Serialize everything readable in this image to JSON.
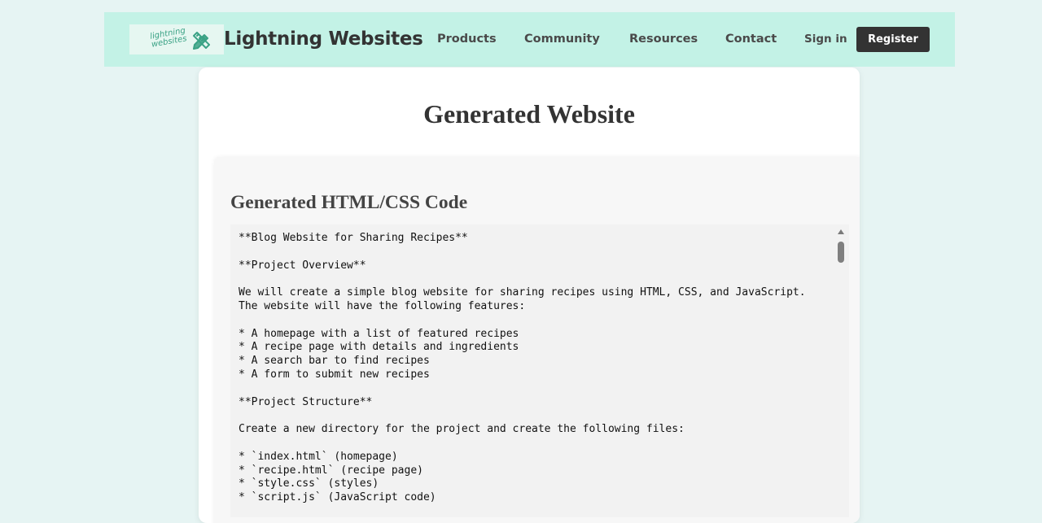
{
  "navbar": {
    "logo_text": "lightning websites",
    "logo_icon": "pencil-ruler-icon",
    "brand": "Lightning Websites",
    "links": [
      {
        "label": "Products"
      },
      {
        "label": "Community"
      },
      {
        "label": "Resources"
      },
      {
        "label": "Contact"
      }
    ],
    "sign_in": "Sign in",
    "register": "Register"
  },
  "page": {
    "title": "Generated Website"
  },
  "code_section": {
    "heading": "Generated HTML/CSS Code",
    "lines": [
      "**Blog Website for Sharing Recipes**",
      "",
      "**Project Overview**",
      "",
      "We will create a simple blog website for sharing recipes using HTML, CSS, and JavaScript.",
      "The website will have the following features:",
      "",
      "* A homepage with a list of featured recipes",
      "* A recipe page with details and ingredients",
      "* A search bar to find recipes",
      "* A form to submit new recipes",
      "",
      "**Project Structure**",
      "",
      "Create a new directory for the project and create the following files:",
      "",
      "* `index.html` (homepage)",
      "* `recipe.html` (recipe page)",
      "* `style.css` (styles)",
      "* `script.js` (JavaScript code)"
    ]
  },
  "colors": {
    "background": "#e6f4f3",
    "navbar": "#c3f2e6",
    "accent": "#3aa285",
    "button": "#333333"
  }
}
